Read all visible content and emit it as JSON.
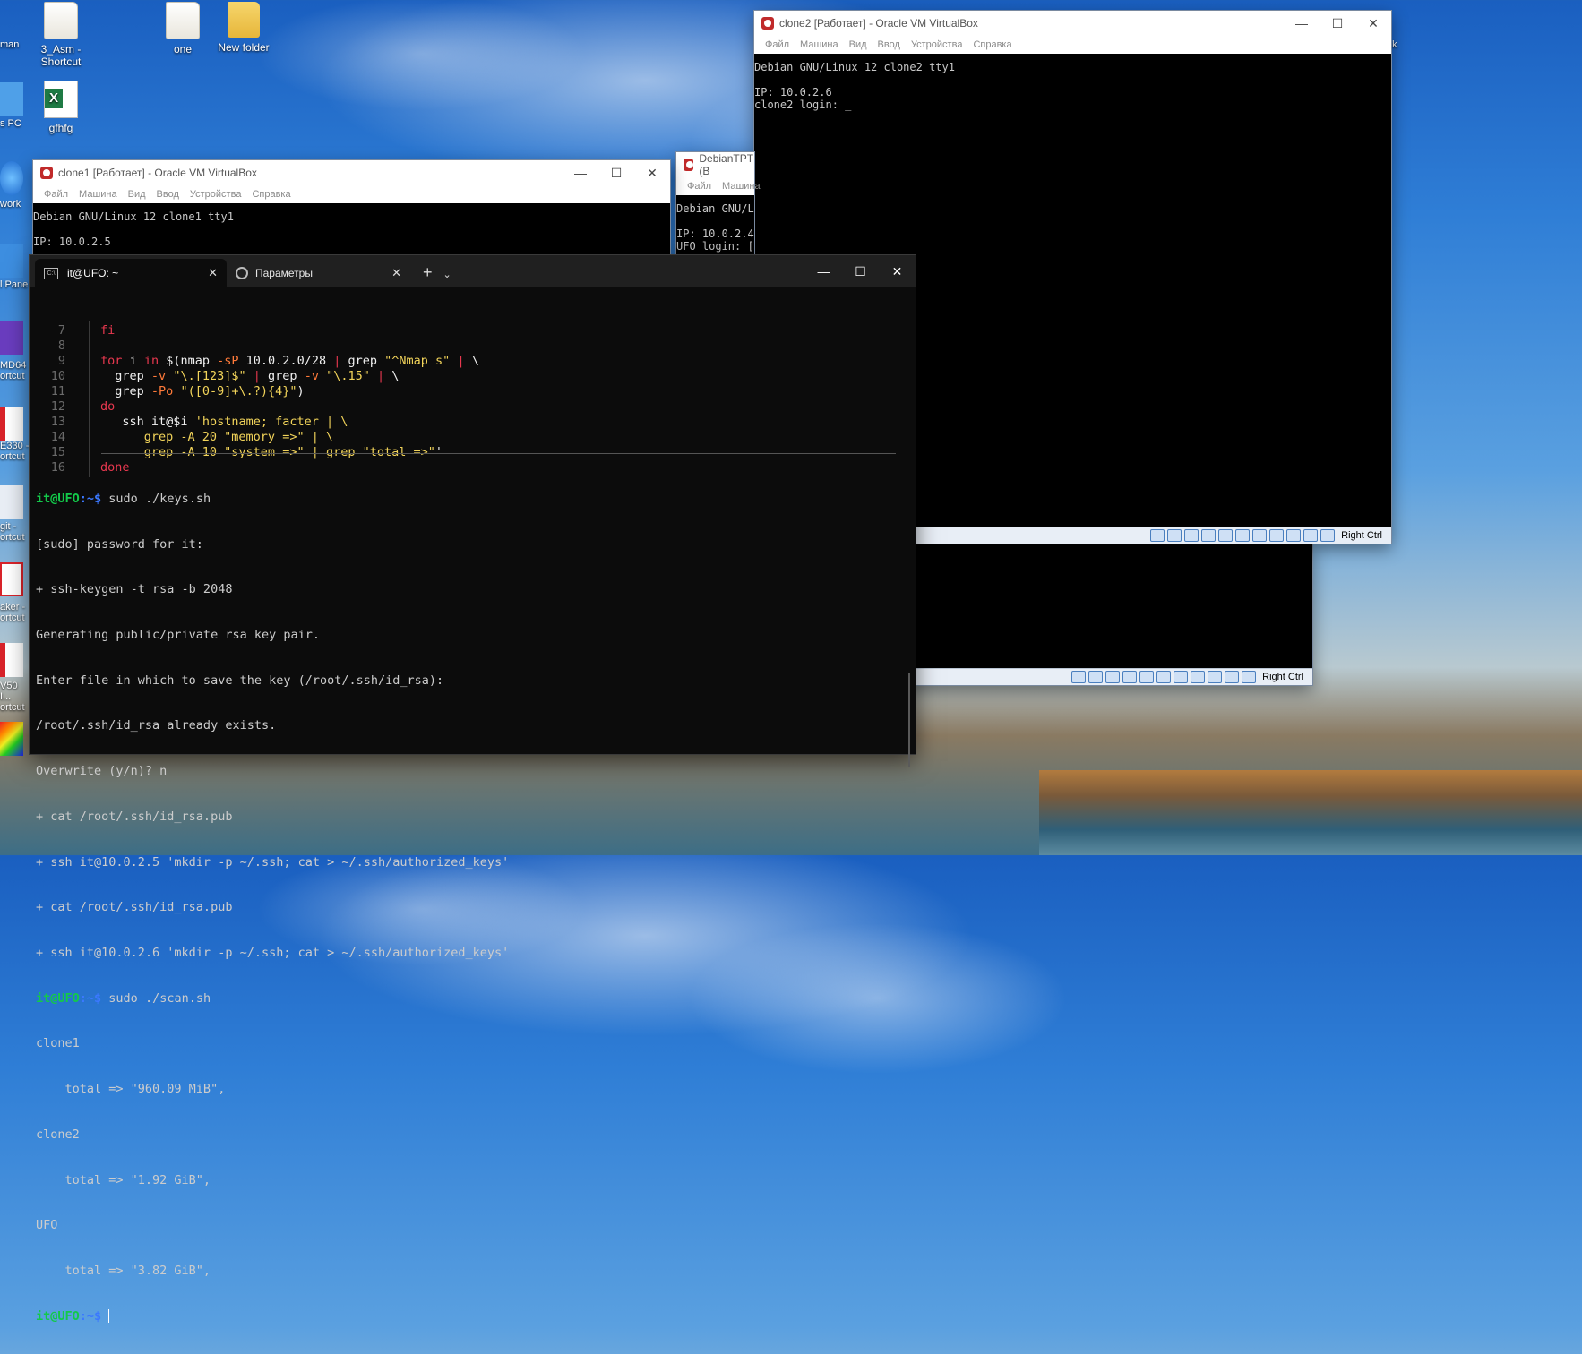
{
  "desktop": {
    "icons": [
      {
        "label": "3_Asm - Shortcut"
      },
      {
        "label": "one"
      },
      {
        "label": "New folder"
      },
      {
        "label": "gfhfg"
      }
    ],
    "edge_labels": [
      "man",
      "s PC",
      "work",
      "l Pane",
      "MD64 ortcut",
      "E330 - ortcut",
      "git - ortcut",
      "aker - ortcut",
      "V50 I... ortcut"
    ],
    "right_edge_label": "ek"
  },
  "clone2": {
    "title": "clone2 [Работает] - Oracle VM VirtualBox",
    "menu": [
      "Файл",
      "Машина",
      "Вид",
      "Ввод",
      "Устройства",
      "Справка"
    ],
    "screen_lines": [
      "Debian GNU/Linux 12 clone2 tty1",
      "",
      "IP: 10.0.2.6",
      "clone2 login: _"
    ],
    "host_key": "Right Ctrl"
  },
  "clone1": {
    "title": "clone1 [Работает] - Oracle VM VirtualBox",
    "menu": [
      "Файл",
      "Машина",
      "Вид",
      "Ввод",
      "Устройства",
      "Справка"
    ],
    "screen_lines": [
      "Debian GNU/Linux 12 clone1 tty1",
      "",
      "IP: 10.0.2.5"
    ]
  },
  "debiantpt": {
    "title": "DebianTPT (B",
    "menu": [
      "Файл",
      "Машина"
    ],
    "screen_lines": [
      "Debian GNU/L",
      "",
      "IP: 10.0.2.4",
      "UFO login: ["
    ]
  },
  "lower_vbox": {
    "host_key": "Right Ctrl"
  },
  "terminal": {
    "tabs": [
      {
        "label": "it@UFO: ~",
        "active": true
      },
      {
        "label": "Параметры",
        "active": false
      }
    ],
    "editor": {
      "line_numbers": [
        "7",
        "8",
        "9",
        "10",
        "11",
        "12",
        "13",
        "14",
        "15",
        "16"
      ]
    },
    "output": {
      "prompt_user": "it@UFO",
      "prompt_path": ":~$",
      "cmd1": " sudo ./keys.sh",
      "lines1": [
        "[sudo] password for it:",
        "+ ssh-keygen -t rsa -b 2048",
        "Generating public/private rsa key pair.",
        "Enter file in which to save the key (/root/.ssh/id_rsa):",
        "/root/.ssh/id_rsa already exists.",
        "Overwrite (y/n)? n",
        "+ cat /root/.ssh/id_rsa.pub",
        "+ ssh it@10.0.2.5 'mkdir -p ~/.ssh; cat > ~/.ssh/authorized_keys'",
        "+ cat /root/.ssh/id_rsa.pub",
        "+ ssh it@10.0.2.6 'mkdir -p ~/.ssh; cat > ~/.ssh/authorized_keys'"
      ],
      "cmd2": " sudo ./scan.sh",
      "lines2": [
        "clone1",
        "    total => \"960.09 MiB\",",
        "clone2",
        "    total => \"1.92 GiB\",",
        "UFO",
        "    total => \"3.82 GiB\","
      ]
    }
  }
}
